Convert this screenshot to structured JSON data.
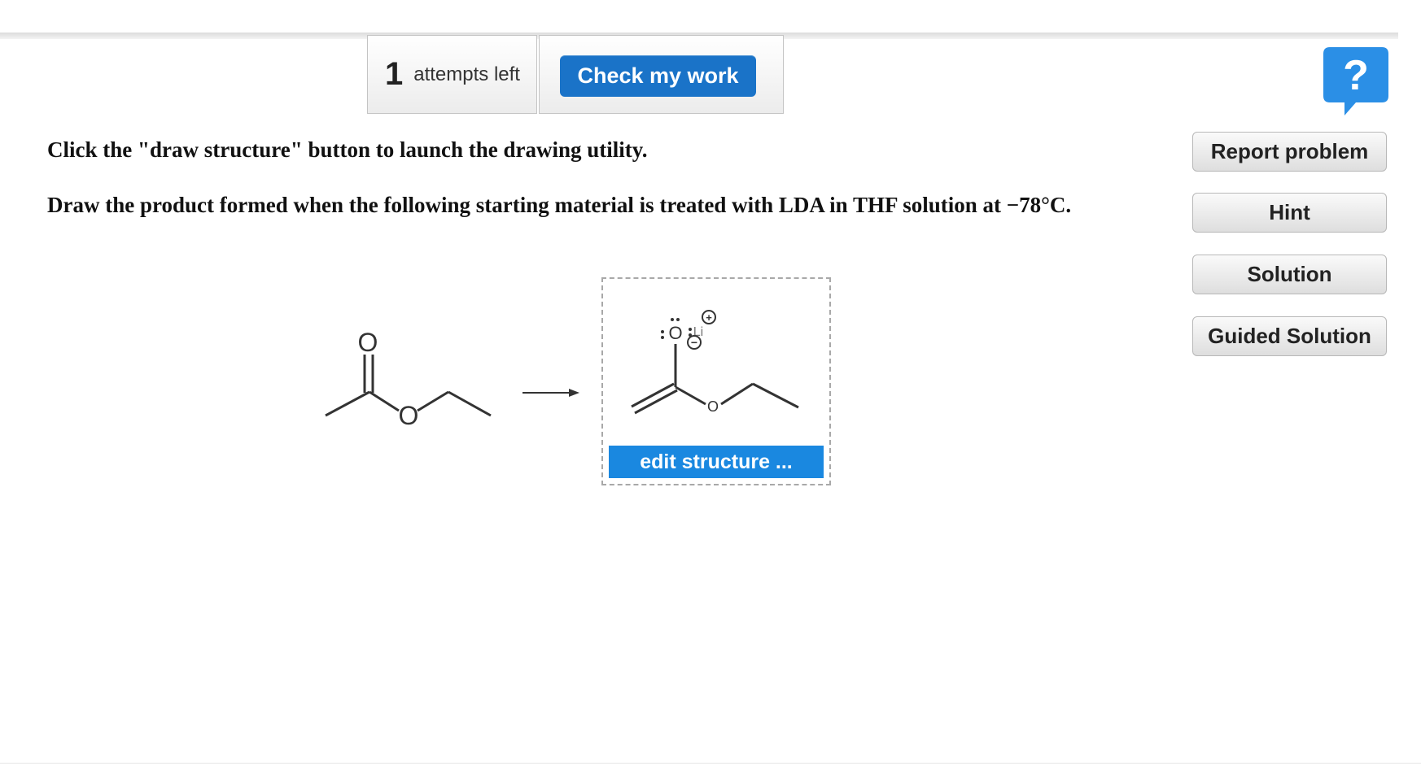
{
  "toolbar": {
    "attempts_count": "1",
    "attempts_label": "attempts left",
    "check_label": "Check my work"
  },
  "help": {
    "icon": "question-bubble-icon",
    "glyph": "?"
  },
  "side": {
    "report": "Report problem",
    "hint": "Hint",
    "solution": "Solution",
    "guided": "Guided Solution"
  },
  "question": {
    "line1": "Click the \"draw structure\" button to launch the drawing utility.",
    "line2": "Draw the product formed when the following starting material is treated with LDA in THF solution at −78°C."
  },
  "chemistry": {
    "reactant_atoms": {
      "carbonyl_o": "O",
      "ester_o": "O"
    },
    "product_atoms": {
      "o_minus": "O",
      "li": "Li",
      "ester_o": "O",
      "plus": "+",
      "minus": "−"
    }
  },
  "editor": {
    "button_label": "edit structure ..."
  },
  "colors": {
    "primary_blue": "#1a73c8",
    "edit_blue": "#1a88e0",
    "help_blue": "#2b8fe6"
  }
}
